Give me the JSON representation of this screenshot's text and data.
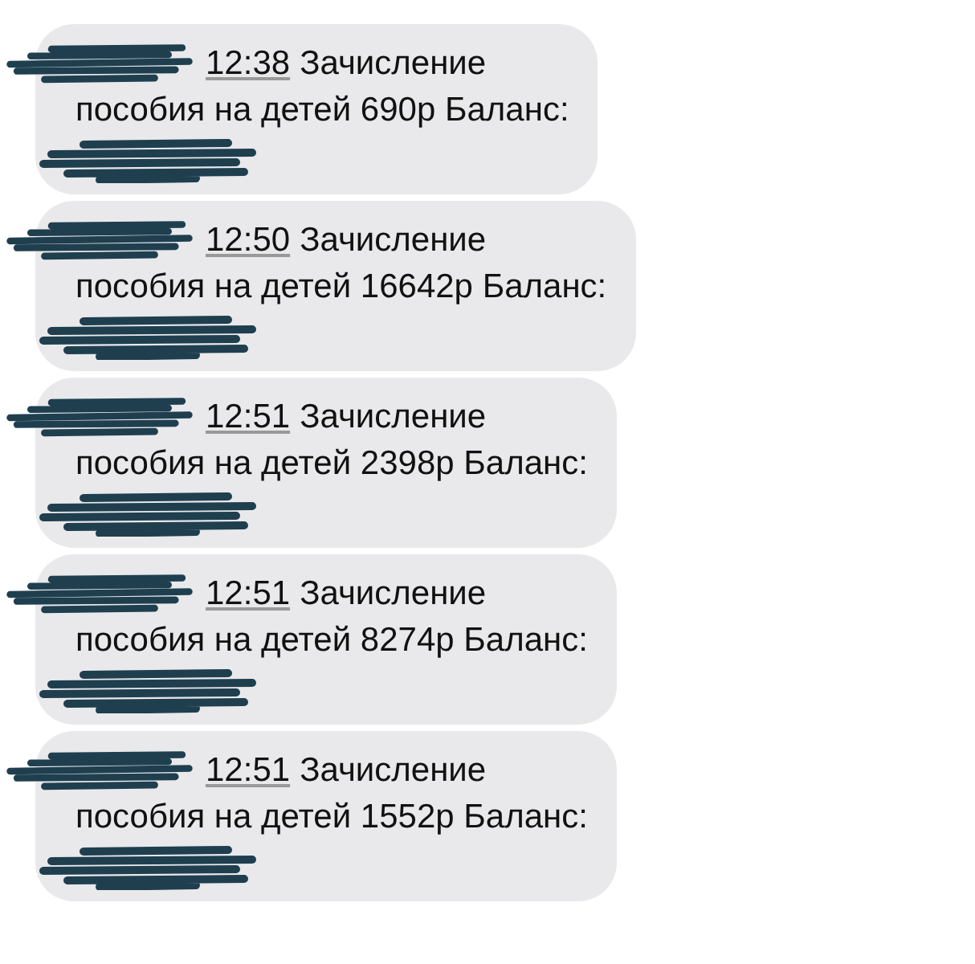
{
  "messages": [
    {
      "time": "12:38",
      "line_1": "Зачисление",
      "line_2": "пособия на детей 690р Баланс:"
    },
    {
      "time": "12:50",
      "line_1": "Зачисление",
      "line_2": "пособия на детей 16642р Баланс:"
    },
    {
      "time": "12:51",
      "line_1": "Зачисление",
      "line_2": "пособия на детей 2398р Баланс:"
    },
    {
      "time": "12:51",
      "line_1": "Зачисление",
      "line_2": "пособия на детей 8274р Баланс:"
    },
    {
      "time": "12:51",
      "line_1": "Зачисление",
      "line_2": "пособия на детей 1552р Баланс:"
    }
  ]
}
